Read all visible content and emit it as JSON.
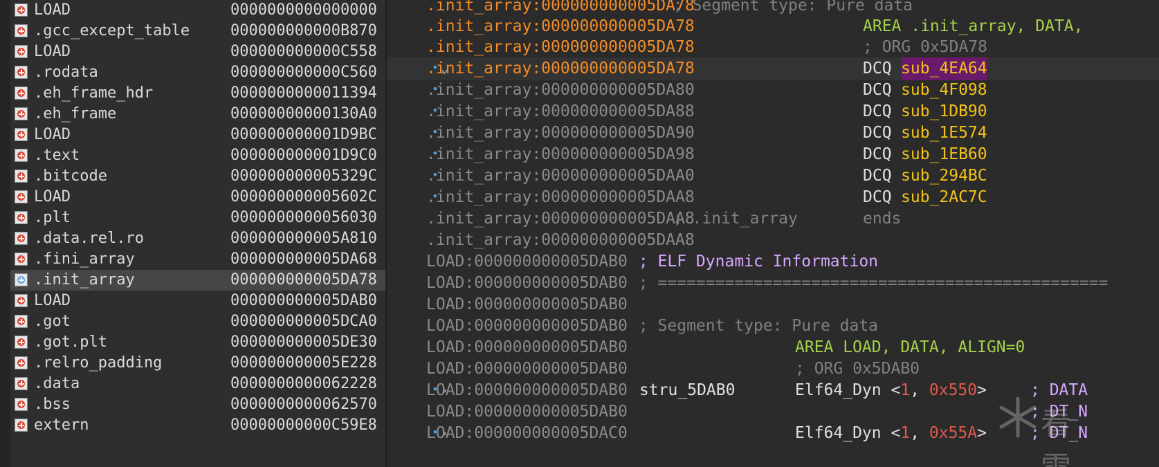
{
  "segments": [
    {
      "name": "LOAD",
      "addr": "0000000000000000"
    },
    {
      "name": ".gcc_except_table",
      "addr": "000000000000B870"
    },
    {
      "name": "LOAD",
      "addr": "000000000000C558"
    },
    {
      "name": ".rodata",
      "addr": "000000000000C560"
    },
    {
      "name": ".eh_frame_hdr",
      "addr": "0000000000011394"
    },
    {
      "name": ".eh_frame",
      "addr": "00000000000130A0"
    },
    {
      "name": "LOAD",
      "addr": "000000000001D9BC"
    },
    {
      "name": ".text",
      "addr": "000000000001D9C0"
    },
    {
      "name": ".bitcode",
      "addr": "000000000005329C"
    },
    {
      "name": "LOAD",
      "addr": "000000000005602C"
    },
    {
      "name": ".plt",
      "addr": "0000000000056030"
    },
    {
      "name": ".data.rel.ro",
      "addr": "000000000005A810"
    },
    {
      "name": ".fini_array",
      "addr": "000000000005DA68"
    },
    {
      "name": ".init_array",
      "addr": "000000000005DA78"
    },
    {
      "name": "LOAD",
      "addr": "000000000005DAB0"
    },
    {
      "name": ".got",
      "addr": "000000000005DCA0"
    },
    {
      "name": ".got.plt",
      "addr": "000000000005DE30"
    },
    {
      "name": ".relro_padding",
      "addr": "000000000005E228"
    },
    {
      "name": ".data",
      "addr": "0000000000062228"
    },
    {
      "name": ".bss",
      "addr": "0000000000062570"
    },
    {
      "name": "extern",
      "addr": "00000000000C59E8"
    }
  ],
  "selected_segment": ".init_array",
  "icons": {
    "segment": "segment-icon",
    "bullet": "bullet-dot-icon",
    "expand": "chevron-right-icon",
    "collapse": "chevron-down-icon",
    "watermark": "snowflake-logo"
  },
  "colors": {
    "segment_orange": "#f28c28",
    "segment_gray": "#8a8a8a",
    "comment": "#808080",
    "directive_green": "#a6d14b",
    "sub_yellow": "#f2c218",
    "highlight": "#6a1a6a",
    "bullet_blue": "#4aa3df"
  },
  "disasm": {
    "line0": {
      "seg": ".init_array:000000000005DA78",
      "comment": " ; Segment type: Pure data"
    },
    "line1": {
      "seg": ".init_array:000000000005DA78",
      "directive": "AREA .init_array, DATA,"
    },
    "line2": {
      "seg": ".init_array:000000000005DA78",
      "comment": "; ORG 0x5DA78"
    },
    "line3": {
      "seg": ".init_array:000000000005DA78",
      "mnem": "DCQ",
      "operand": "sub_4EA64"
    },
    "line4": {
      "seg": ".init_array:000000000005DA80",
      "mnem": "DCQ",
      "operand": "sub_4F098"
    },
    "line5": {
      "seg": ".init_array:000000000005DA88",
      "mnem": "DCQ",
      "operand": "sub_1DB90"
    },
    "line6": {
      "seg": ".init_array:000000000005DA90",
      "mnem": "DCQ",
      "operand": "sub_1E574"
    },
    "line7": {
      "seg": ".init_array:000000000005DA98",
      "mnem": "DCQ",
      "operand": "sub_1EB60"
    },
    "line8": {
      "seg": ".init_array:000000000005DAA0",
      "mnem": "DCQ",
      "operand": "sub_294BC"
    },
    "line9": {
      "seg": ".init_array:000000000005DAA8",
      "mnem": "DCQ",
      "operand": "sub_2AC7C"
    },
    "line10": {
      "seg": ".init_array:000000000005DAA8",
      "comment": " ; .init_array",
      "ends": "ends"
    },
    "line11": {
      "seg": ".init_array:000000000005DAA8"
    },
    "line12": {
      "seg": "LOAD:000000000005DAB0",
      "comment": " ; ELF Dynamic Information"
    },
    "line13": {
      "seg": "LOAD:000000000005DAB0",
      "comment": " ; ==============================================="
    },
    "line14": {
      "seg": "LOAD:000000000005DAB0"
    },
    "line15": {
      "seg": "LOAD:000000000005DAB0",
      "comment": " ; Segment type: Pure data"
    },
    "line16": {
      "seg": "LOAD:000000000005DAB0",
      "directive": "AREA LOAD, DATA, ALIGN=0"
    },
    "line17": {
      "seg": "LOAD:000000000005DAB0",
      "comment": "; ORG 0x5DAB0"
    },
    "line18": {
      "seg": "LOAD:000000000005DAB0",
      "label": "stru_5DAB0",
      "type": "Elf64_Dyn <",
      "n1": "1",
      "sep": ", ",
      "n2": "0x550",
      "close": ">",
      "comment": "; DATA"
    },
    "line19": {
      "seg": "LOAD:000000000005DAB0",
      "comment": "; DT_N"
    },
    "line20": {
      "seg": "LOAD:000000000005DAC0",
      "type": "Elf64_Dyn <",
      "n1": "1",
      "sep": ", ",
      "n2": "0x55A",
      "close": ">",
      "comment": "; DT_N"
    }
  },
  "watermark_text": "看雪"
}
